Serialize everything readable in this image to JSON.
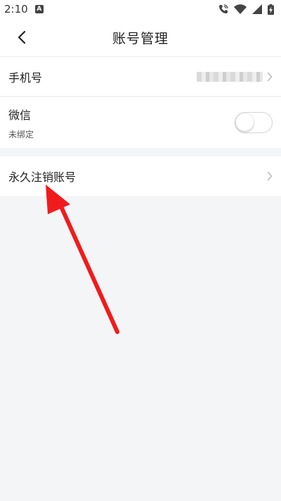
{
  "status_bar": {
    "time": "2:10",
    "badge_letter": "A",
    "icons": [
      "phone-call-icon",
      "wifi-icon",
      "signal-icon",
      "battery-charging-icon"
    ]
  },
  "header": {
    "title": "账号管理",
    "back_icon": "chevron-left-icon"
  },
  "settings": {
    "phone": {
      "label": "手机号"
    },
    "wechat": {
      "label": "微信",
      "status": "未绑定",
      "bound": false
    },
    "cancel_account": {
      "label": "永久注销账号"
    }
  },
  "colors": {
    "background": "#f4f5f7",
    "card": "#ffffff",
    "annotation_arrow": "#f21b1b"
  }
}
